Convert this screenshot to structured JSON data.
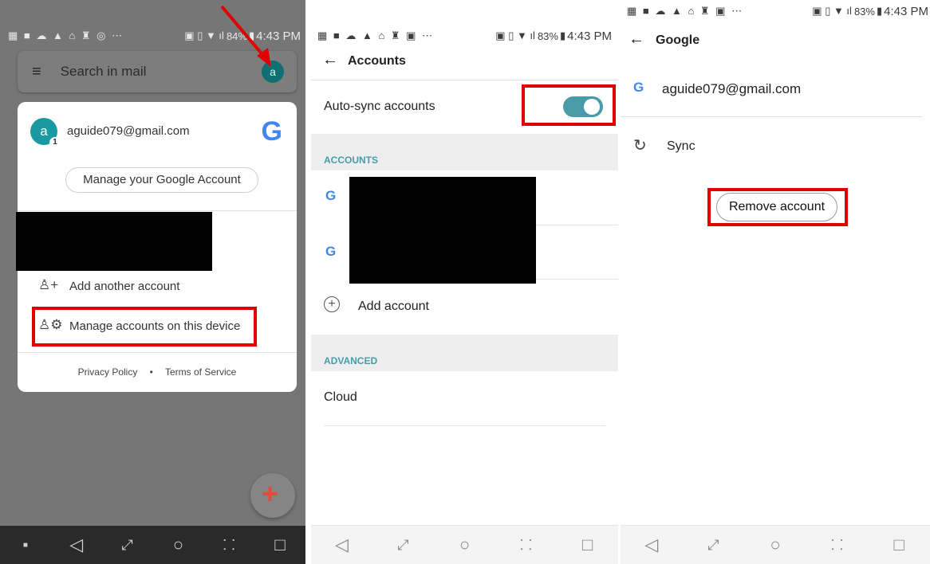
{
  "colors": {
    "accent": "#4a9ba8",
    "highlight": "#e00000",
    "avatar": "#1a9aa0",
    "section_header": "#4a9ba8"
  },
  "panel1": {
    "status_bar": {
      "battery": "84%",
      "time": "4:43 PM"
    },
    "search_placeholder": "Search in mail",
    "avatar_letter": "a",
    "card": {
      "avatar_letter": "a",
      "avatar_badge": "1",
      "email": "aguide079@gmail.com",
      "manage_button": "Manage your Google Account",
      "add_account": "Add another account",
      "manage_device": "Manage accounts on this device",
      "privacy": "Privacy Policy",
      "bullet": "•",
      "terms": "Terms of Service"
    }
  },
  "panel2": {
    "status_bar": {
      "battery": "83%",
      "time": "4:43 PM"
    },
    "title": "Accounts",
    "auto_sync": "Auto-sync accounts",
    "auto_sync_on": true,
    "accounts_header": "ACCOUNTS",
    "add_account": "Add account",
    "advanced_header": "ADVANCED",
    "cloud": "Cloud"
  },
  "panel3": {
    "status_bar": {
      "battery": "83%",
      "time": "4:43 PM"
    },
    "title": "Google",
    "email": "aguide079@gmail.com",
    "sync": "Sync",
    "remove_button": "Remove account"
  },
  "icons": {
    "back": "arrow-left-icon",
    "menu": "hamburger-icon",
    "google": "google-g-icon",
    "sync": "sync-icon",
    "add": "plus-circle-icon"
  }
}
